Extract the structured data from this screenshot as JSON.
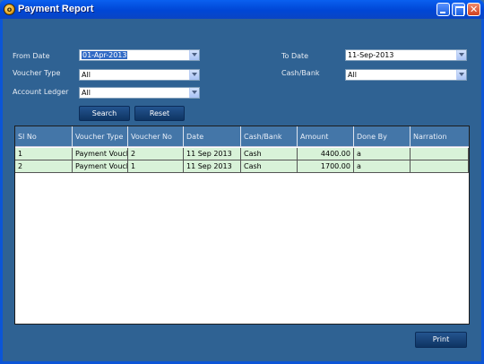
{
  "window": {
    "title": "Payment Report"
  },
  "filters": {
    "from_date_label": "From Date",
    "from_date_value": "01-Apr-2013",
    "to_date_label": "To Date",
    "to_date_value": "11-Sep-2013",
    "voucher_type_label": "Voucher Type",
    "voucher_type_value": "All",
    "cash_bank_label": "Cash/Bank",
    "cash_bank_value": "All",
    "account_ledger_label": "Account Ledger",
    "account_ledger_value": "All"
  },
  "buttons": {
    "search": "Search",
    "reset": "Reset",
    "print": "Print"
  },
  "table": {
    "columns": [
      "Sl No",
      "Voucher Type",
      "Voucher No",
      "Date",
      "Cash/Bank",
      "Amount",
      "Done By",
      "Narration"
    ],
    "rows": [
      [
        "1",
        "Payment Voucher",
        "2",
        "11 Sep 2013",
        "Cash",
        "4400.00",
        "a",
        ""
      ],
      [
        "2",
        "Payment Voucher",
        "1",
        "11 Sep 2013",
        "Cash",
        "1700.00",
        "a",
        ""
      ]
    ]
  },
  "icons": {
    "app": "app-logo-icon",
    "minimize": "minimize-icon",
    "maximize": "maximize-icon",
    "close": "close-icon",
    "dropdown": "chevron-down-icon"
  }
}
